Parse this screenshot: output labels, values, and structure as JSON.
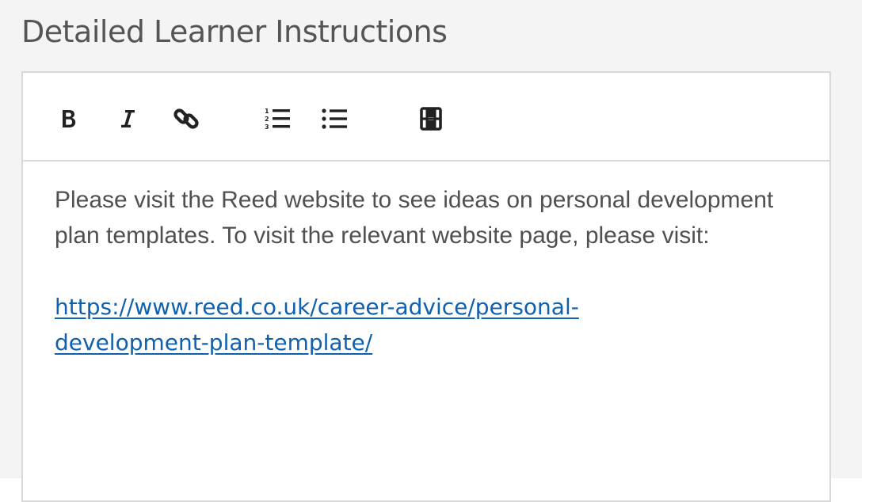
{
  "section": {
    "title": "Detailed Learner Instructions"
  },
  "toolbar": {
    "buttons": [
      {
        "name": "bold",
        "icon": "bold-icon"
      },
      {
        "name": "italic",
        "icon": "italic-icon"
      },
      {
        "name": "link",
        "icon": "link-icon"
      },
      {
        "name": "ordered-list",
        "icon": "ordered-list-icon"
      },
      {
        "name": "unordered-list",
        "icon": "unordered-list-icon"
      },
      {
        "name": "video",
        "icon": "film-icon"
      }
    ]
  },
  "editor": {
    "paragraph": "Please visit the Reed website to see ideas on personal development plan templates. To visit the relevant website page, please visit:",
    "link_text": "https://www.reed.co.uk/career-advice/personal-development-plan-template/"
  },
  "colors": {
    "background": "#f4f4f4",
    "border": "#d9d9d9",
    "title_text": "#555555",
    "body_text": "#505050",
    "link": "#1060b0",
    "icon": "#222222"
  }
}
